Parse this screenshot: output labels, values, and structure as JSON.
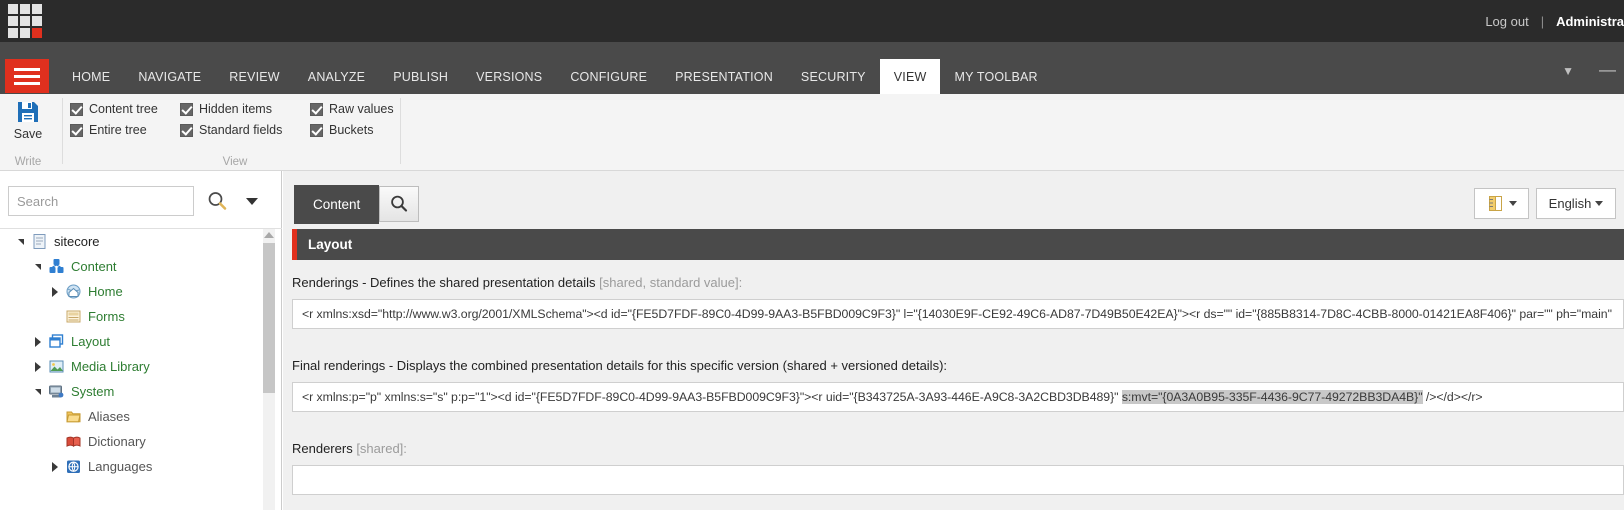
{
  "topbar": {
    "logo_name": "sitecore-logo",
    "logout_label": "Log out",
    "separator": "|",
    "user_label": "Administra"
  },
  "ribbon": {
    "menu_icon": "hamburger-icon",
    "tabs": [
      {
        "label": "HOME",
        "active": false
      },
      {
        "label": "NAVIGATE",
        "active": false
      },
      {
        "label": "REVIEW",
        "active": false
      },
      {
        "label": "ANALYZE",
        "active": false
      },
      {
        "label": "PUBLISH",
        "active": false
      },
      {
        "label": "VERSIONS",
        "active": false
      },
      {
        "label": "CONFIGURE",
        "active": false
      },
      {
        "label": "PRESENTATION",
        "active": false
      },
      {
        "label": "SECURITY",
        "active": false
      },
      {
        "label": "VIEW",
        "active": true
      },
      {
        "label": "MY TOOLBAR",
        "active": false
      }
    ],
    "collapse_icon": "chevron-down-icon",
    "minimize_icon": "minimize-icon",
    "groups": {
      "write": {
        "label": "Write",
        "save_label": "Save"
      },
      "view": {
        "label": "View",
        "checkboxes": [
          {
            "label": "Content tree",
            "checked": true
          },
          {
            "label": "Entire tree",
            "checked": true
          },
          {
            "label": "Hidden items",
            "checked": true
          },
          {
            "label": "Standard fields",
            "checked": true
          },
          {
            "label": "Raw values",
            "checked": true
          },
          {
            "label": "Buckets",
            "checked": true
          }
        ]
      }
    }
  },
  "sidebar": {
    "search": {
      "placeholder": "Search",
      "value": "",
      "go_icon": "search-icon",
      "options_icon": "chevron-down-icon"
    },
    "tree": [
      {
        "label": "sitecore",
        "indent": 0,
        "arrow": "expanded",
        "icon": "document-icon",
        "color": "dark"
      },
      {
        "label": "Content",
        "indent": 1,
        "arrow": "expanded",
        "icon": "content-cubes-icon",
        "color": "green"
      },
      {
        "label": "Home",
        "indent": 2,
        "arrow": "collapsed",
        "icon": "home-globe-icon",
        "color": "green"
      },
      {
        "label": "Forms",
        "indent": 2,
        "arrow": "none",
        "icon": "forms-icon",
        "color": "green"
      },
      {
        "label": "Layout",
        "indent": 1,
        "arrow": "collapsed",
        "icon": "layout-icon",
        "color": "green"
      },
      {
        "label": "Media Library",
        "indent": 1,
        "arrow": "collapsed",
        "icon": "media-image-icon",
        "color": "green"
      },
      {
        "label": "System",
        "indent": 1,
        "arrow": "expanded",
        "icon": "system-icon",
        "color": "green"
      },
      {
        "label": "Aliases",
        "indent": 2,
        "arrow": "none",
        "icon": "folder-icon",
        "color": "gray"
      },
      {
        "label": "Dictionary",
        "indent": 2,
        "arrow": "none",
        "icon": "book-icon",
        "color": "gray"
      },
      {
        "label": "Languages",
        "indent": 2,
        "arrow": "collapsed",
        "icon": "globe-icon",
        "color": "gray"
      }
    ],
    "scrollbar": {
      "up_icon": "scroll-up-arrow-icon"
    }
  },
  "content": {
    "tab_content_label": "Content",
    "tab_search_icon": "search-icon",
    "version_icon": "version-notebook-icon",
    "version_caret_icon": "chevron-down-icon",
    "language_label": "English",
    "language_caret_icon": "chevron-down-icon",
    "section_title": "Layout",
    "fields": [
      {
        "label_main": "Renderings - Defines the shared presentation details ",
        "label_muted": "[shared, standard value]:",
        "value_plain": "<r xmlns:xsd=\"http://www.w3.org/2001/XMLSchema\"><d id=\"{FE5D7FDF-89C0-4D99-9AA3-B5FBD009C9F3}\" l=\"{14030E9F-CE92-49C6-AD87-7D49B50E42EA}\"><r ds=\"\" id=\"{885B8314-7D8C-4CBB-8000-01421EA8F406}\" par=\"\" ph=\"main\"",
        "selection": ""
      },
      {
        "label_main": "Final renderings - Displays the combined presentation details for this specific version (shared + versioned details):",
        "label_muted": "",
        "value_prefix": "<r xmlns:p=\"p\" xmlns:s=\"s\" p:p=\"1\"><d id=\"{FE5D7FDF-89C0-4D99-9AA3-B5FBD009C9F3}\"><r uid=\"{B343725A-3A93-446E-A9C8-3A2CBD3DB489}\" ",
        "value_selected": "s:mvt=\"{0A3A0B95-335F-4436-9C77-49272BB3DA4B}\"",
        "value_suffix": " /></d></r>",
        "selection": "s:mvt=\"{0A3A0B95-335F-4436-9C77-49272BB3DA4B}\""
      },
      {
        "label_main": "Renderers ",
        "label_muted": "[shared]:",
        "value_plain": "",
        "selection": ""
      }
    ]
  },
  "colors": {
    "brand_red": "#e0301e",
    "dark_chrome": "#2b2b2b",
    "ribbon_gray": "#4a4a4a",
    "tree_green": "#2e7d32"
  }
}
